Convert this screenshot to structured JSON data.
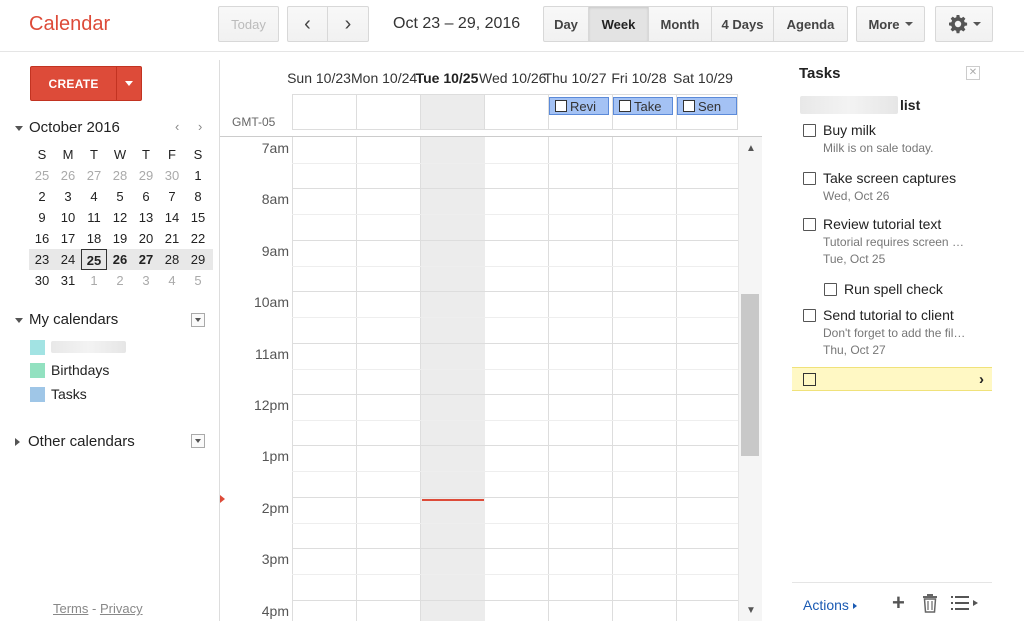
{
  "app": {
    "title": "Calendar"
  },
  "toolbar": {
    "today": "Today",
    "prev": "‹",
    "next": "›",
    "date_range": "Oct 23 – 29, 2016",
    "views": [
      "Day",
      "Week",
      "Month",
      "4 Days",
      "Agenda"
    ],
    "active_view": "Week",
    "more": "More"
  },
  "sidebar": {
    "create": "CREATE",
    "mini_calendar": {
      "month": "October 2016",
      "weekdays": [
        "S",
        "M",
        "T",
        "W",
        "T",
        "F",
        "S"
      ],
      "weeks": [
        [
          "25",
          "26",
          "27",
          "28",
          "29",
          "30",
          "1"
        ],
        [
          "2",
          "3",
          "4",
          "5",
          "6",
          "7",
          "8"
        ],
        [
          "9",
          "10",
          "11",
          "12",
          "13",
          "14",
          "15"
        ],
        [
          "16",
          "17",
          "18",
          "19",
          "20",
          "21",
          "22"
        ],
        [
          "23",
          "24",
          "25",
          "26",
          "27",
          "28",
          "29"
        ],
        [
          "30",
          "31",
          "1",
          "2",
          "3",
          "4",
          "5"
        ]
      ],
      "today": "25"
    },
    "my_calendars": {
      "label": "My calendars",
      "items": [
        {
          "label": "",
          "color": "#a2e3e3"
        },
        {
          "label": "Birthdays",
          "color": "#92e1c0"
        },
        {
          "label": "Tasks",
          "color": "#9fc6e7"
        }
      ]
    },
    "other_calendars": {
      "label": "Other calendars"
    },
    "footer": {
      "terms": "Terms",
      "separator": " - ",
      "privacy": "Privacy"
    }
  },
  "week": {
    "timezone": "GMT-05",
    "days": [
      "Sun 10/23",
      "Mon 10/24",
      "Tue 10/25",
      "Wed 10/26",
      "Thu 10/27",
      "Fri 10/28",
      "Sat 10/29"
    ],
    "today_index": 2,
    "hours": [
      "7am",
      "8am",
      "9am",
      "10am",
      "11am",
      "12pm",
      "1pm",
      "2pm",
      "3pm",
      "4pm"
    ],
    "all_day_chips": [
      {
        "label": "Revi",
        "day_index": 2
      },
      {
        "label": "Take",
        "day_index": 3
      },
      {
        "label": "Sen",
        "day_index": 4
      }
    ]
  },
  "tasks": {
    "title": "Tasks",
    "list_name": "list",
    "items": [
      {
        "title": "Buy milk",
        "note": "Milk is on sale today.",
        "due": ""
      },
      {
        "title": "Take screen captures",
        "note": "",
        "due": "Wed, Oct 26"
      },
      {
        "title": "Review tutorial text",
        "note": "Tutorial requires screen …",
        "due": "Tue, Oct 25"
      },
      {
        "title": "Run spell check",
        "note": "",
        "due": "",
        "subtask": true
      },
      {
        "title": "Send tutorial to client",
        "note": "Don't forget to add the fil…",
        "due": "Thu, Oct 27"
      }
    ],
    "actions": "Actions"
  },
  "colors": {
    "accent": "#dd4b39",
    "event": "#a4c2f4",
    "link": "#1a5ab3"
  }
}
